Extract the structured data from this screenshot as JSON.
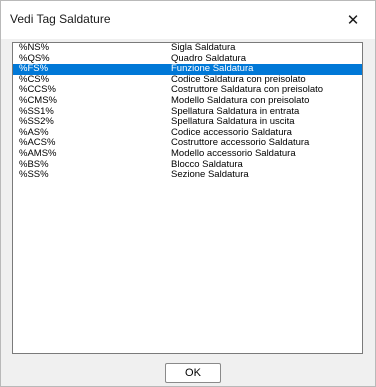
{
  "window": {
    "title": "Vedi Tag Saldature",
    "close_glyph": "✕"
  },
  "list": {
    "selected_index": 2,
    "items": [
      {
        "tag": "%NS%",
        "desc": "Sigla Saldatura"
      },
      {
        "tag": "%QS%",
        "desc": "Quadro Saldatura"
      },
      {
        "tag": "%FS%",
        "desc": "Funzione Saldatura"
      },
      {
        "tag": "%CS%",
        "desc": "Codice Saldatura con preisolato"
      },
      {
        "tag": "%CCS%",
        "desc": "Costruttore Saldatura con preisolato"
      },
      {
        "tag": "%CMS%",
        "desc": "Modello Saldatura con preisolato"
      },
      {
        "tag": "%SS1%",
        "desc": "Spellatura Saldatura in entrata"
      },
      {
        "tag": "%SS2%",
        "desc": "Spellatura Saldatura in uscita"
      },
      {
        "tag": "%AS%",
        "desc": "Codice accessorio Saldatura"
      },
      {
        "tag": "%ACS%",
        "desc": "Costruttore accessorio Saldatura"
      },
      {
        "tag": "%AMS%",
        "desc": "Modello accessorio Saldatura"
      },
      {
        "tag": "%BS%",
        "desc": "Blocco Saldatura"
      },
      {
        "tag": "%SS%",
        "desc": "Sezione Saldatura"
      }
    ]
  },
  "buttons": {
    "ok_label": "OK"
  }
}
